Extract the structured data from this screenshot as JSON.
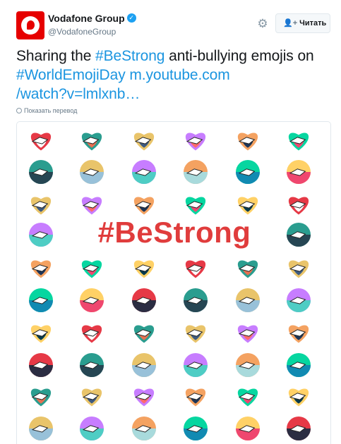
{
  "header": {
    "display_name": "Vodafone Group",
    "handle": "@VodafoneGroup",
    "follow_label": "Читать"
  },
  "tweet": {
    "text_prefix": "Sharing the ",
    "hashtag1": "#BeStrong",
    "text_middle": " anti-bullying emojis on",
    "hashtag2": "#WorldEmojiDay",
    "link": "m.youtube.com/watch?v=lmlxnb…",
    "link_line1": "m.youtube.com",
    "link_line2": "/watch?v=lmlxnb…"
  },
  "translate_label": "Показать перевод",
  "media": {
    "banner_text": "#BeStrong"
  },
  "icons": {
    "avatar": "vodafone-logo",
    "verified": "verified-badge-icon",
    "gear": "gear-icon",
    "follow": "add-user-icon",
    "translate": "globe-icon"
  },
  "colors": {
    "brand_red": "#e60000",
    "link_blue": "#1b95e0",
    "banner_red": "#e03c3c"
  }
}
